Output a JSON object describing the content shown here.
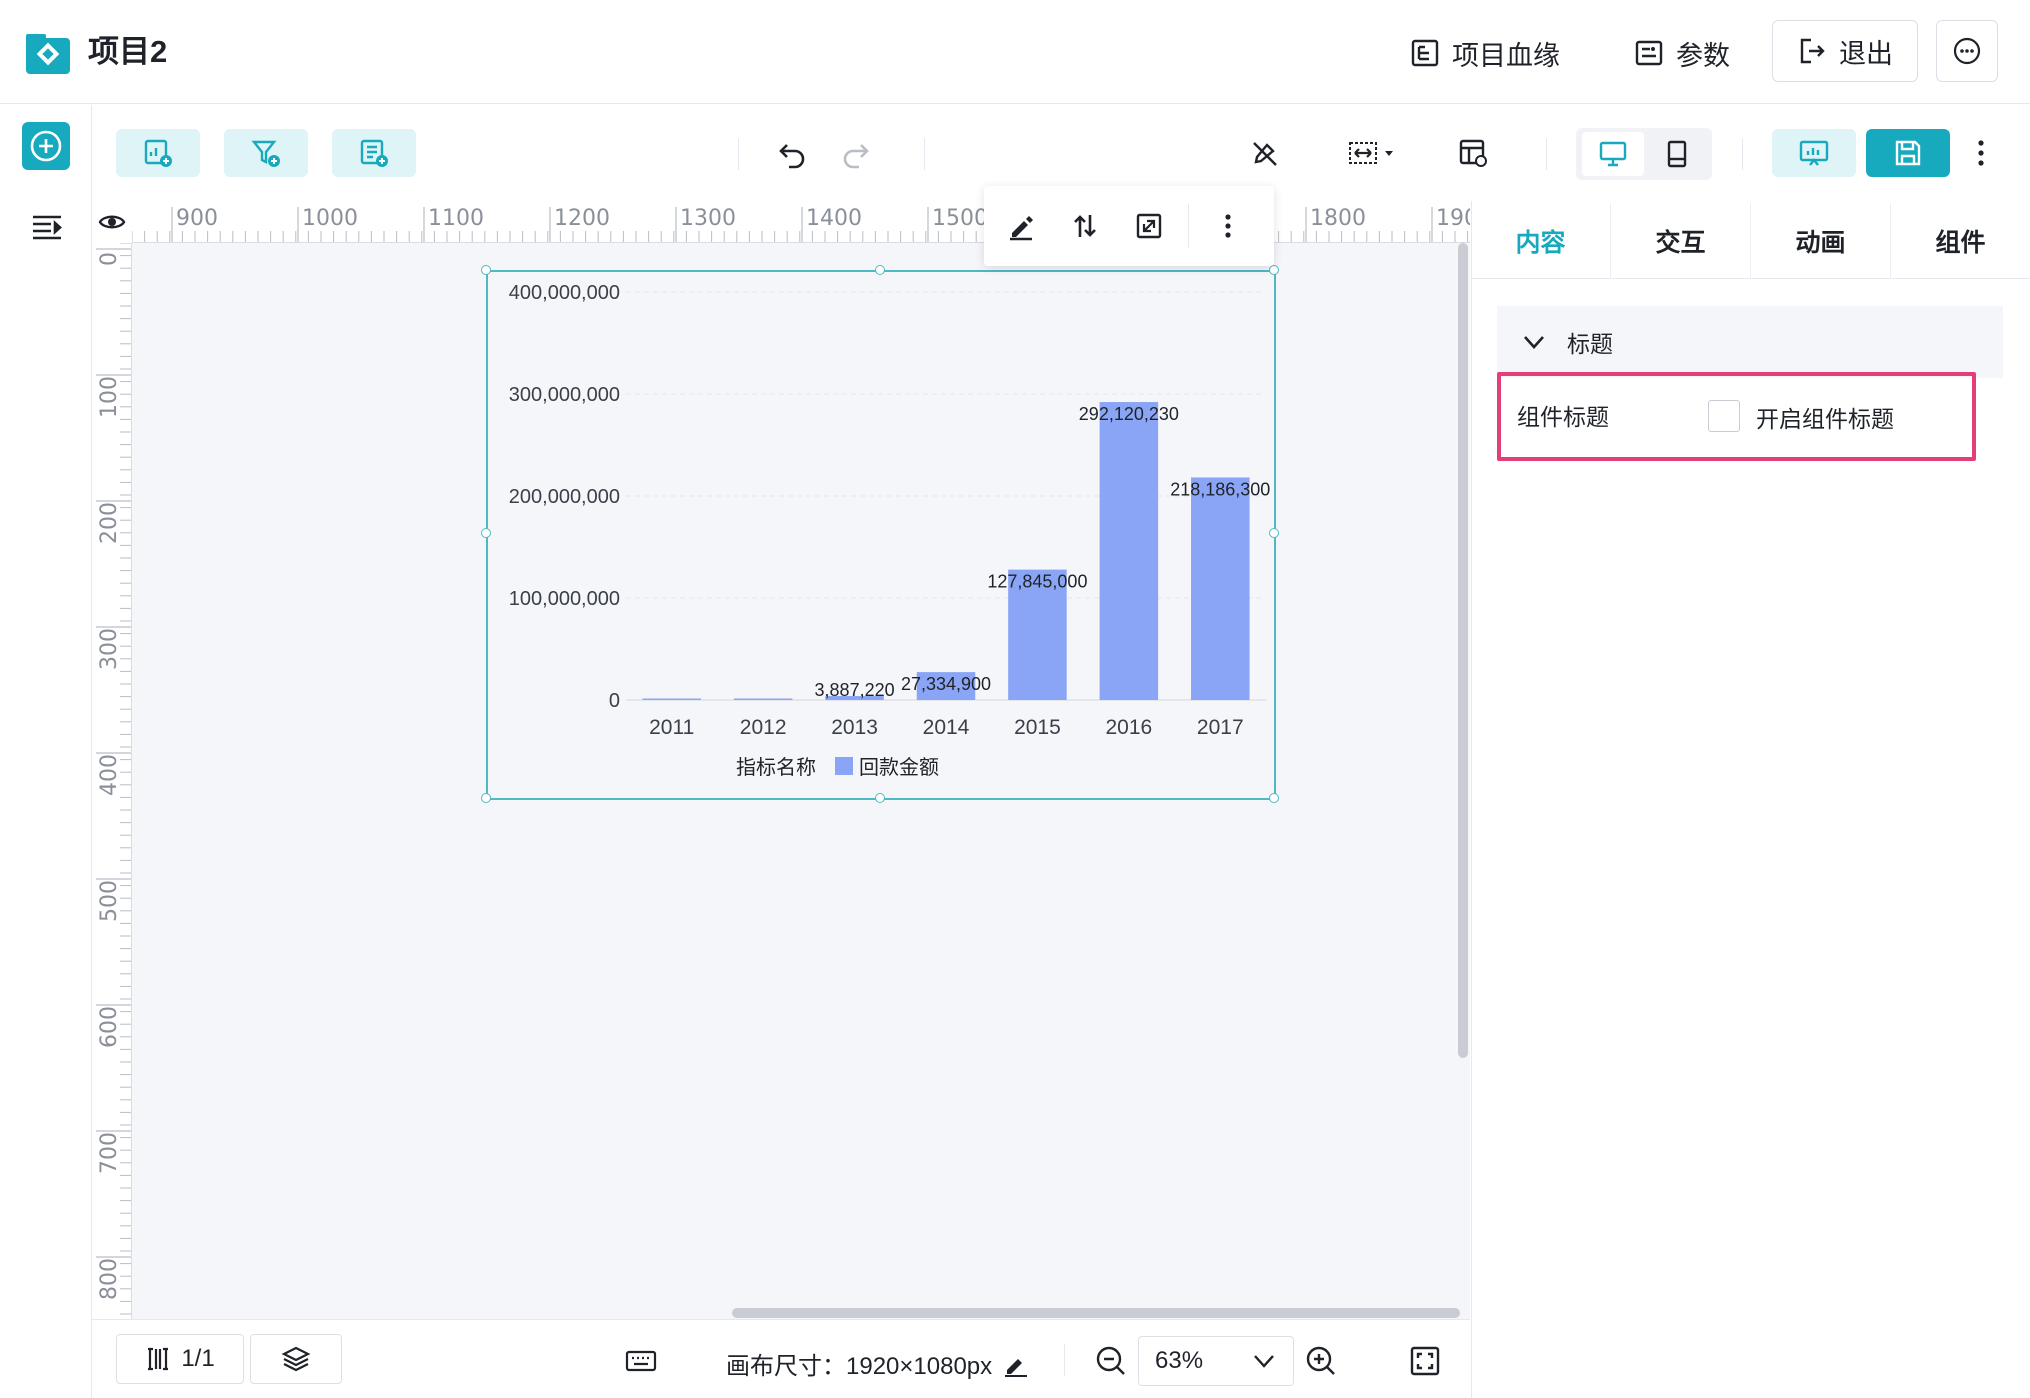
{
  "header": {
    "title": "项目2",
    "lineage_label": "项目血缘",
    "params_label": "参数",
    "exit_label": "退出"
  },
  "ruler": {
    "x_ticks": [
      "900",
      "1000",
      "1100",
      "1200",
      "1300",
      "1400",
      "1500",
      "1800",
      "190"
    ],
    "y_ticks": [
      "0",
      "100",
      "200",
      "300",
      "400",
      "500",
      "600",
      "700",
      "800"
    ]
  },
  "chart_data": {
    "type": "bar",
    "categories": [
      "2011",
      "2012",
      "2013",
      "2014",
      "2015",
      "2016",
      "2017"
    ],
    "series": [
      {
        "name": "回款金额",
        "values": [
          600000,
          700000,
          3887220,
          27334900,
          127845000,
          292120230,
          218186300
        ],
        "labels": [
          "",
          "",
          "3,887,220",
          "27,334,900",
          "127,845,000",
          "292,120,230",
          "218,186,300"
        ],
        "color": "#8aa5f5"
      }
    ],
    "ytick_labels": [
      "400,000,000",
      "300,000,000",
      "200,000,000",
      "100,000,000",
      "0"
    ],
    "ylim": [
      0,
      400000000
    ],
    "legend_title": "指标名称",
    "legend_position": "bottom",
    "grid": true
  },
  "right_panel": {
    "tabs": [
      "内容",
      "交互",
      "动画",
      "组件"
    ],
    "active_tab": "内容",
    "section_title": "标题",
    "field_label": "组件标题",
    "checkbox_label": "开启组件标题",
    "checkbox_checked": false
  },
  "bottom_bar": {
    "page_indicator": "1/1",
    "canvas_size_label": "画布尺寸：1920×1080px",
    "zoom_value": "63%"
  },
  "colors": {
    "accent": "#17a9be",
    "highlight": "#e33e7a",
    "bar": "#8aa5f5"
  }
}
